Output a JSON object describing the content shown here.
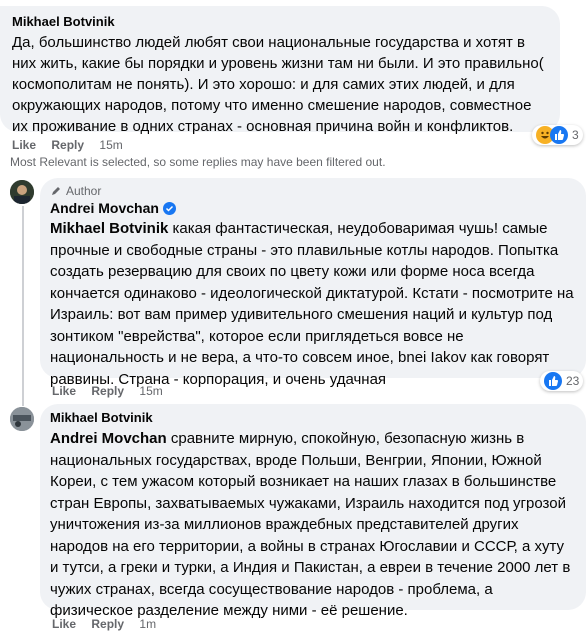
{
  "comments": [
    {
      "author": "Mikhael Botvinik",
      "text": "Да, большинство людей любят свои национальные государства и хотят в них жить, какие бы порядки и уровень жизни там ни были. И это правильно( космополитам не понять). И это хорошо: и для самих этих людей, и для окружающих народов, потому что именно смешение народов, совместное их проживание в одних странах - основная причина войн и конфликтов.",
      "like": "Like",
      "reply": "Reply",
      "time": "15m",
      "reaction_count": "3"
    }
  ],
  "filter_note": "Most Relevant is selected, so some replies may have been filtered out.",
  "replies": [
    {
      "badge": "Author",
      "author": "Andrei Movchan",
      "mention": "Mikhael Botvinik",
      "text": " какая фантастическая, неудобоваримая чушь! самые прочные и свободные страны - это плавильные котлы народов. Попытка создать резервацию для своих по цвету кожи или форме носа всегда кончается одинаково - идеологической диктатурой. Кстати - посмотрите на Израиль: вот вам пример удивительного смешения наций и культур под зонтиком \"еврейства\", которое если приглядеться вовсе не национальность и не вера, а что-то совсем иное, bnei Iakov как говорят раввины. Страна - корпорация, и очень удачная",
      "like": "Like",
      "reply": "Reply",
      "time": "15m",
      "reaction_count": "23"
    },
    {
      "author": "Mikhael Botvinik",
      "mention": "Andrei Movchan",
      "text": " сравните мирную, спокойную, безопасную жизнь в национальных государствах, вроде Польши, Венгрии, Японии, Южной Кореи, с тем ужасом который возникает на наших глазах в большинстве стран Европы, захватываемых чужаками, Израиль находится под угрозой уничтожения из-за миллионов враждебных представителей других народов на его территории, а войны в странах Югославии и СССР, а хуту и тутси, а греки и турки, а Индия и Пакистан, а евреи в течение 2000 лет в чужих странах, всегда сосуществование народов - проблема, а физическое разделение между ними - её решение.",
      "like": "Like",
      "reply": "Reply",
      "time": "1m"
    }
  ],
  "colors": {
    "bubble": "#f0f2f5",
    "meta": "#65676b",
    "like_blue": "#1877f2",
    "verified": "#1877f2"
  }
}
